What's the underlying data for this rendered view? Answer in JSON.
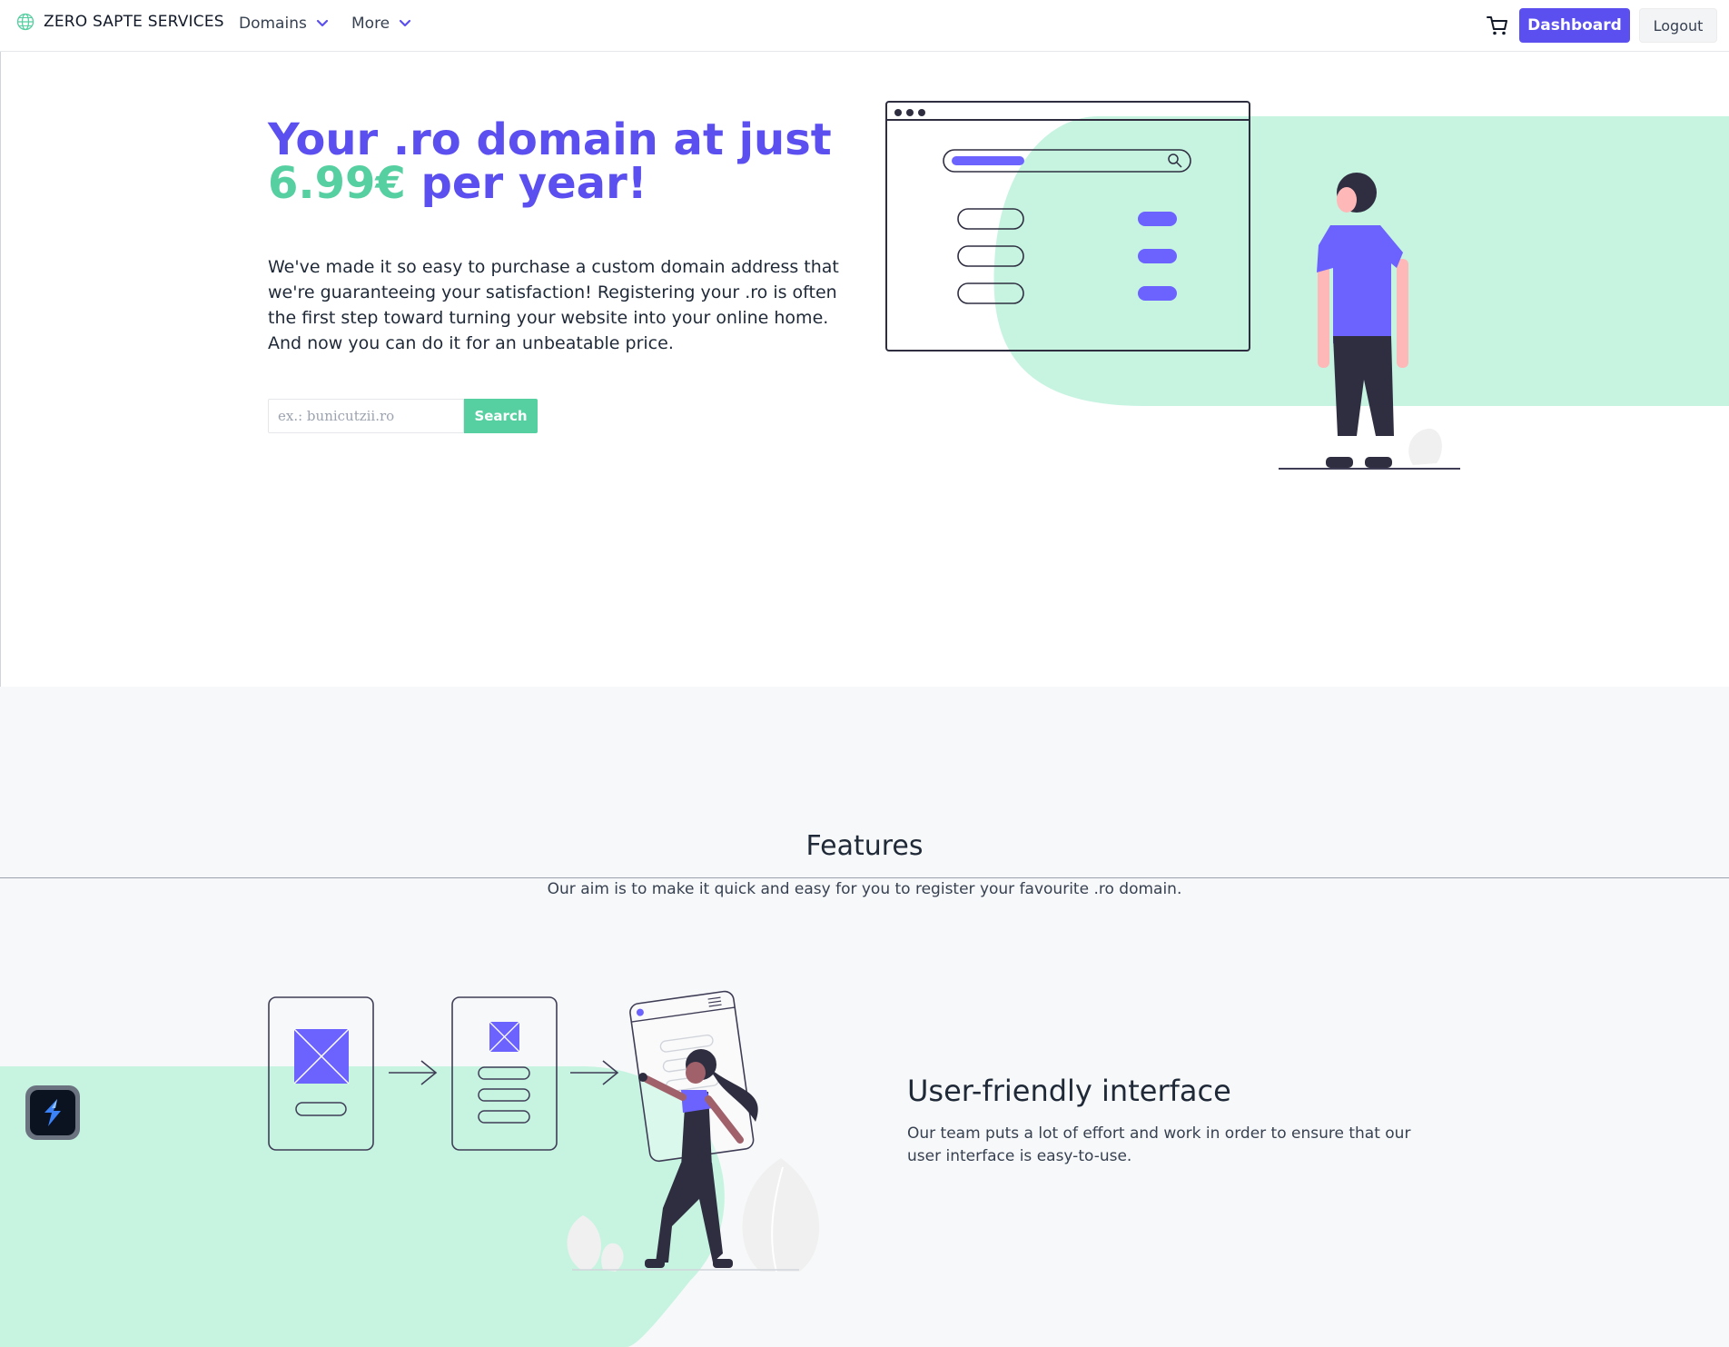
{
  "nav": {
    "brand": "ZERO SAPTE SERVICES",
    "links": [
      {
        "label": "Domains"
      },
      {
        "label": "More"
      }
    ],
    "dashboard_label": "Dashboard",
    "logout_label": "Logout"
  },
  "hero": {
    "title_line1": "Your .ro domain at just",
    "price": "6.99€",
    "title_rest": " per year!",
    "description": "We've made it so easy to purchase a custom domain address that we're guaranteeing your satisfaction! Registering your .ro is often the first step toward turning your website into your online home. And now you can do it for an unbeatable price.",
    "search_placeholder": "ex.: bunicutzii.ro",
    "search_label": "Search"
  },
  "features": {
    "title": "Features",
    "subtitle": "Our aim is to make it quick and easy for you to register your favourite .ro domain.",
    "item_title": "User-friendly interface",
    "item_desc": "Our team puts a lot of effort and work in order to ensure that our user interface is easy-to-use."
  },
  "colors": {
    "brand_purple": "#5b4ff0",
    "accent_green": "#56cfa1",
    "mint_bg": "#c6f4e1"
  },
  "icons": [
    "globe-icon",
    "chevron-down-icon",
    "cart-icon",
    "app-launcher-icon"
  ]
}
